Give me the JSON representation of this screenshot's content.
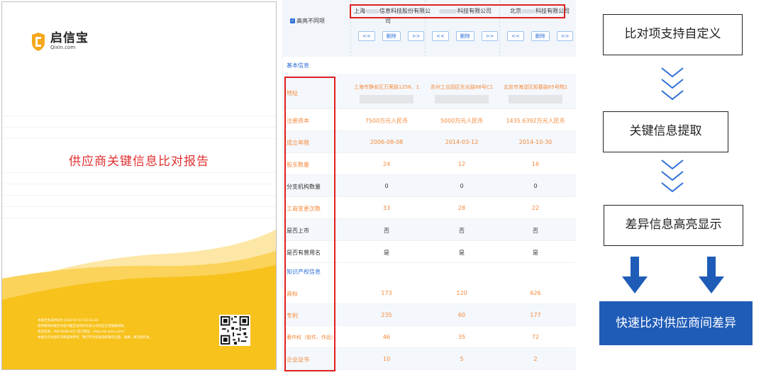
{
  "cover": {
    "logo_cn": "启信宝",
    "logo_en": "Qixin.com",
    "title": "供应商关键信息比对报告",
    "notes": [
      "本报告生成时间为 2020-07-23 16:33:36",
      "您所看到的报告内容为截至该时间点该公司的启信宝数据快照。",
      "电话咨询：400-8286-855   官方网址：https://b.qixin.com/",
      "本报告仅为您的决策提供参考，我们不对该查询结果的全面、准确、真实性负责。"
    ],
    "colors": {
      "accent": "#f7c21c",
      "title": "#e03030"
    }
  },
  "panel": {
    "highlight_label": "高亮不同项",
    "companies": [
      {
        "prefix": "上海",
        "suffix": "信息科技股份有限公",
        "wrap": "司"
      },
      {
        "prefix": "",
        "suffix": "科技有限公司",
        "wrap": ""
      },
      {
        "prefix": "北京",
        "suffix": "科技有限公司",
        "wrap": ""
      }
    ],
    "controls": {
      "prev": "<<",
      "delete": "删除",
      "next": ">>"
    },
    "section_basic": "基本信息",
    "section_ip": "知识产权信息",
    "rows_basic": [
      {
        "label": "地址",
        "values": [
          "上海市静安区万荣路1256、1",
          "苏州工业园区东长路88号C1",
          "北京市海淀区知春路65号院1"
        ],
        "diff": true
      },
      {
        "label": "注册资本",
        "values": [
          "7500万元人民币",
          "5000万元人民币",
          "1435.6392万元人民币"
        ],
        "diff": true
      },
      {
        "label": "成立年限",
        "values": [
          "2006-08-08",
          "2014-03-12",
          "2014-10-30"
        ],
        "diff": true
      },
      {
        "label": "股东数量",
        "values": [
          "24",
          "12",
          "16"
        ],
        "diff": true
      },
      {
        "label": "分支机构数量",
        "values": [
          "0",
          "0",
          "0"
        ],
        "diff": false
      },
      {
        "label": "工商变更次数",
        "values": [
          "33",
          "28",
          "22"
        ],
        "diff": true
      },
      {
        "label": "是否上市",
        "values": [
          "否",
          "否",
          "否"
        ],
        "diff": false
      },
      {
        "label": "是否有曾用名",
        "values": [
          "是",
          "是",
          "是"
        ],
        "diff": false
      }
    ],
    "rows_ip": [
      {
        "label": "商标",
        "values": [
          "173",
          "120",
          "626"
        ],
        "diff": true
      },
      {
        "label": "专利",
        "values": [
          "235",
          "60",
          "177"
        ],
        "diff": true
      },
      {
        "label": "著作权（软件、作品）",
        "values": [
          "46",
          "35",
          "72"
        ],
        "diff": true
      },
      {
        "label": "企业证书",
        "values": [
          "10",
          "5",
          "2"
        ],
        "diff": true
      }
    ],
    "colors": {
      "diff": "#f5893a",
      "same": "#333333",
      "link": "#2f6fd8",
      "highlight_box": "#e02020"
    }
  },
  "flow": {
    "step1": "比对项支持自定义",
    "step2": "关键信息提取",
    "step3": "差异信息高亮显示",
    "result": "快速比对供应商间差异",
    "colors": {
      "chevron": "#2f6fd8",
      "result_bg": "#1f5cb8"
    }
  }
}
